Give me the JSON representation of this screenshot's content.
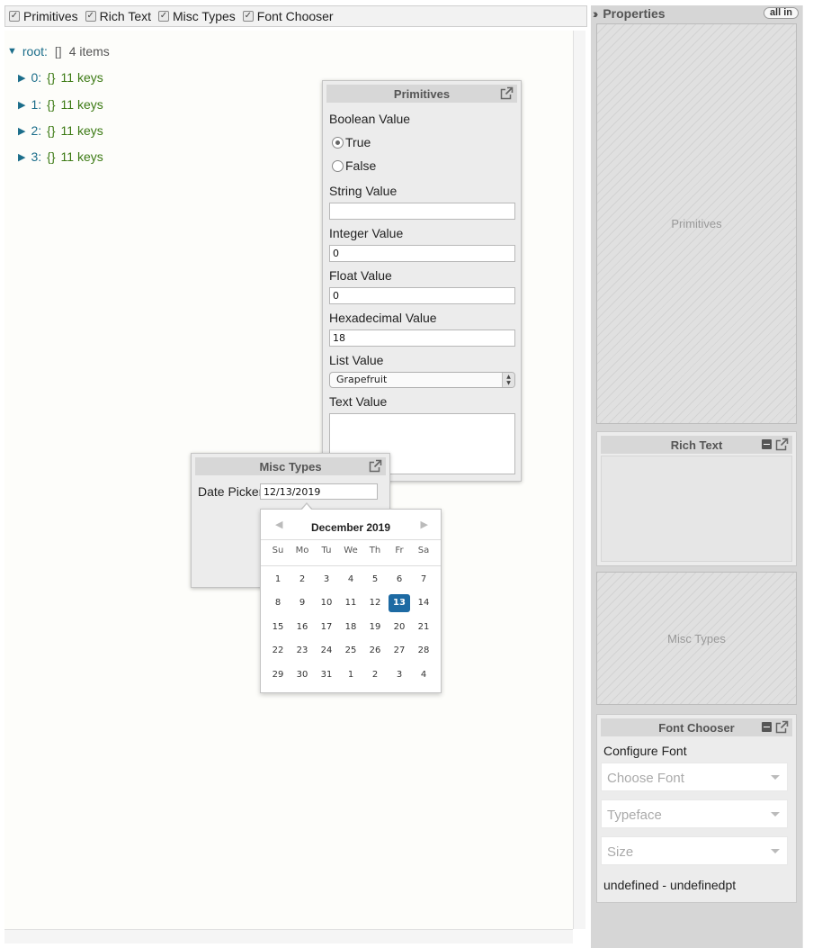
{
  "toolbar": {
    "checkboxes": [
      {
        "label": "Primitives",
        "checked": true
      },
      {
        "label": "Rich Text",
        "checked": true
      },
      {
        "label": "Misc Types",
        "checked": true
      },
      {
        "label": "Font Chooser",
        "checked": true
      }
    ]
  },
  "tree": {
    "root": {
      "key": "root:",
      "brackets": "[]",
      "count": "4 items"
    },
    "children": [
      {
        "key": "0:",
        "brackets": "{}",
        "count": "11 keys"
      },
      {
        "key": "1:",
        "brackets": "{}",
        "count": "11 keys"
      },
      {
        "key": "2:",
        "brackets": "{}",
        "count": "11 keys"
      },
      {
        "key": "3:",
        "brackets": "{}",
        "count": "11 keys"
      }
    ]
  },
  "primitives_panel": {
    "title": "Primitives",
    "boolean_label": "Boolean Value",
    "true_label": "True",
    "false_label": "False",
    "boolean_selected": "True",
    "string_label": "String Value",
    "string_value": "",
    "integer_label": "Integer Value",
    "integer_value": "0",
    "float_label": "Float Value",
    "float_value": "0",
    "hex_label": "Hexadecimal Value",
    "hex_value": "18",
    "list_label": "List Value",
    "list_value": "Grapefruit",
    "text_label": "Text Value",
    "text_value": ""
  },
  "misc_panel": {
    "title": "Misc Types",
    "date_label": "Date Picker",
    "date_value": "12/13/2019"
  },
  "datepicker": {
    "month_title": "December 2019",
    "weekdays": [
      "Su",
      "Mo",
      "Tu",
      "We",
      "Th",
      "Fr",
      "Sa"
    ],
    "weeks": [
      [
        "1",
        "2",
        "3",
        "4",
        "5",
        "6",
        "7"
      ],
      [
        "8",
        "9",
        "10",
        "11",
        "12",
        "13",
        "14"
      ],
      [
        "15",
        "16",
        "17",
        "18",
        "19",
        "20",
        "21"
      ],
      [
        "22",
        "23",
        "24",
        "25",
        "26",
        "27",
        "28"
      ],
      [
        "29",
        "30",
        "31",
        "1",
        "2",
        "3",
        "4"
      ]
    ],
    "selected_day": "13",
    "selected_color": "#1d6aa3"
  },
  "properties": {
    "title": "Properties",
    "all_in_label": "all in",
    "primitives_placeholder": "Primitives",
    "rich_text_title": "Rich Text",
    "misc_placeholder": "Misc Types",
    "font_chooser": {
      "title": "Font Chooser",
      "configure_label": "Configure Font",
      "font_placeholder": "Choose Font",
      "typeface_placeholder": "Typeface",
      "size_placeholder": "Size",
      "summary": "undefined - undefinedpt"
    }
  }
}
